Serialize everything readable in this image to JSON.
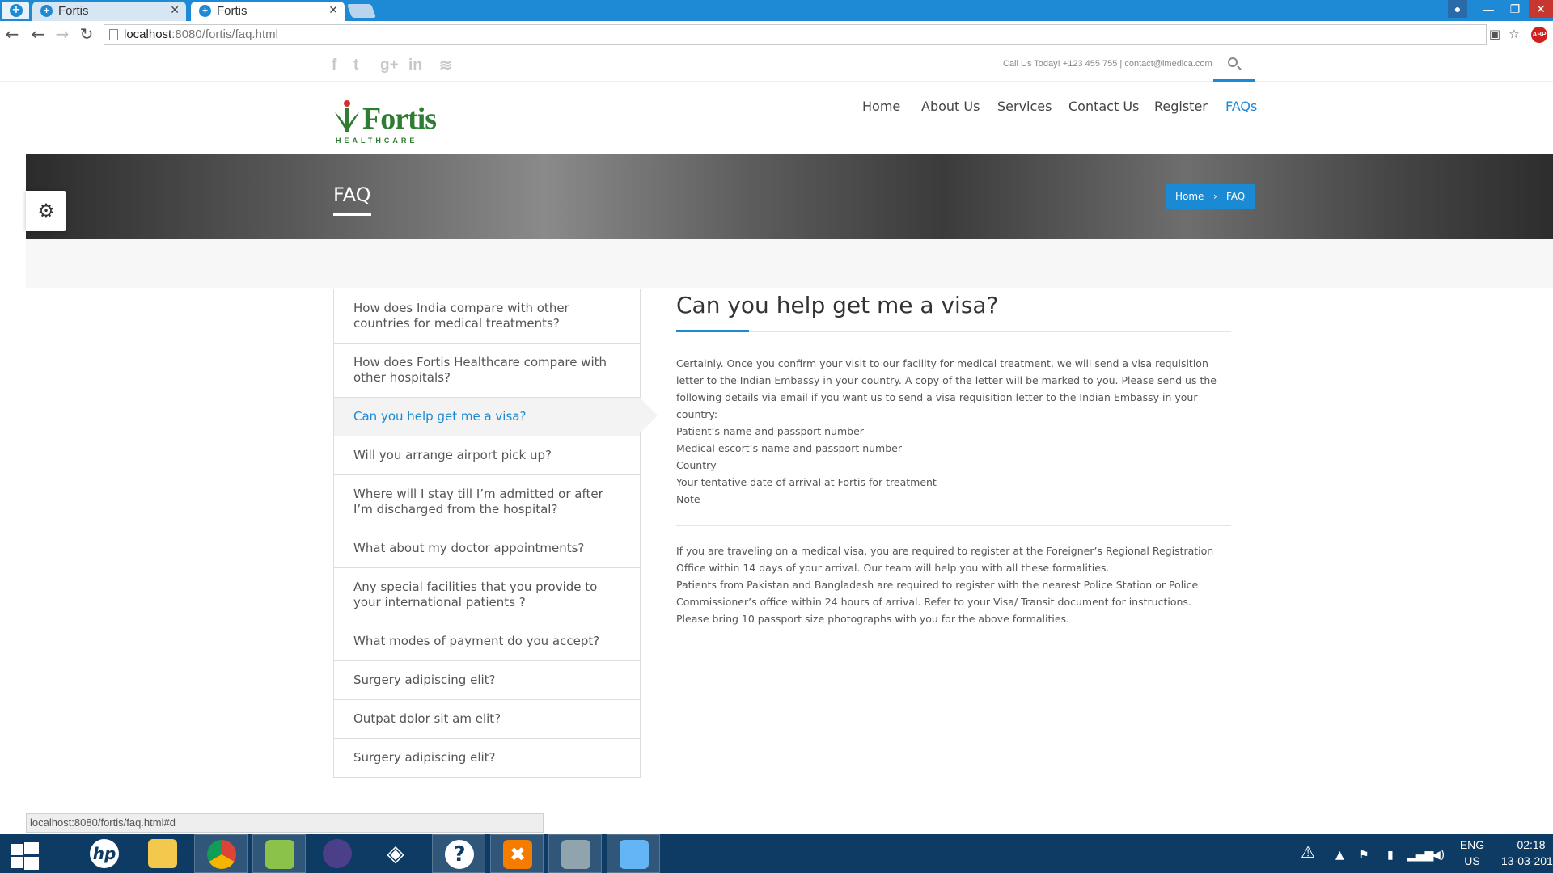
{
  "browser": {
    "tabs": [
      {
        "title": "Fortis",
        "active": false
      },
      {
        "title": "Fortis",
        "active": true
      }
    ],
    "url_host": "localhost",
    "url_rest": ":8080/fortis/faq.html",
    "status_url": "localhost:8080/fortis/faq.html#d"
  },
  "topbar": {
    "contact": "Call Us Today! +123 455 755 | contact@imedica.com",
    "social_icons": [
      "facebook-icon",
      "twitter-icon",
      "google-plus-icon",
      "linkedin-icon",
      "rss-icon"
    ]
  },
  "logo": {
    "word": "Fortis",
    "sub": "HEALTHCARE"
  },
  "nav": [
    {
      "label": "Home"
    },
    {
      "label": "About Us"
    },
    {
      "label": "Services"
    },
    {
      "label": "Contact Us"
    },
    {
      "label": "Register"
    },
    {
      "label": "FAQs",
      "active": true
    }
  ],
  "banner": {
    "title": "FAQ",
    "breadcrumb": {
      "home": "Home",
      "sep": "›",
      "current": "FAQ"
    }
  },
  "faq_list": [
    {
      "label": "How does India compare with other countries for medical treatments?"
    },
    {
      "label": "How does Fortis Healthcare compare with other hospitals?"
    },
    {
      "label": "Can you help get me a visa?",
      "active": true
    },
    {
      "label": "Will you arrange airport pick up?"
    },
    {
      "label": "Where will I stay till I’m admitted or after I’m discharged from the hospital?"
    },
    {
      "label": "What about my doctor appointments?"
    },
    {
      "label": "Any special facilities that you provide to your international patients ?"
    },
    {
      "label": "What modes of payment do you accept?"
    },
    {
      "label": "Surgery adipiscing elit?"
    },
    {
      "label": "Outpat dolor sit am elit?"
    },
    {
      "label": "Surgery adipiscing elit?"
    }
  ],
  "content": {
    "title": "Can you help get me a visa?",
    "intro": "Certainly. Once you confirm your visit to our facility for medical treatment, we will send a visa requisition letter to the Indian Embassy in your country. A copy of the letter will be marked to you. Please send us the following details via email if you want us to send a visa requisition letter to the Indian Embassy in your country:",
    "details": [
      " Patient’s name and passport number",
      " Medical escort’s name and passport number",
      " Country",
      " Your tentative date of arrival at Fortis for treatment"
    ],
    "note_label": "Note",
    "notes": [
      " If you are traveling on a medical visa, you are required to register at the Foreigner’s Regional Registration Office within 14 days of your arrival. Our team will help you with all these formalities.",
      " Patients from Pakistan and Bangladesh are required to register with the nearest Police Station or Police Commissioner’s office within 24 hours of arrival. Refer to your Visa/ Transit document for instructions.",
      " Please bring 10 passport size photographs with you for the above formalities."
    ]
  },
  "taskbar": {
    "apps": [
      "start-icon",
      "hp-icon",
      "file-explorer-icon",
      "chrome-icon",
      "notepad-icon",
      "eclipse-icon",
      "unity-icon",
      "help-icon",
      "xampp-icon",
      "paint-icon",
      "photos-icon"
    ],
    "lang_top": "ENG",
    "lang_bottom": "US",
    "time": "02:18",
    "date": "13-03-201"
  },
  "colors": {
    "accent": "#1a8ad4",
    "brand_green": "#2e7d32",
    "tabstrip": "#1e8ad6",
    "taskbar": "#0e3b63"
  }
}
